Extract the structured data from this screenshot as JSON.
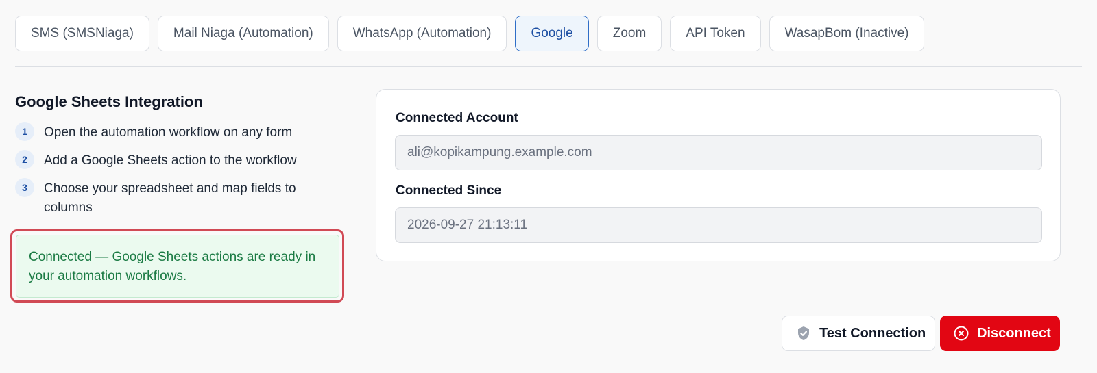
{
  "tabs": [
    {
      "label": "SMS (SMSNiaga)"
    },
    {
      "label": "Mail Niaga (Automation)"
    },
    {
      "label": "WhatsApp (Automation)"
    },
    {
      "label": "Google",
      "active": true
    },
    {
      "label": "Zoom"
    },
    {
      "label": "API Token"
    },
    {
      "label": "WasapBom (Inactive)"
    }
  ],
  "integration": {
    "title": "Google Sheets Integration",
    "steps": [
      {
        "number": "1",
        "text": "Open the automation workflow on any form"
      },
      {
        "number": "2",
        "text": "Add a Google Sheets action to the workflow"
      },
      {
        "number": "3",
        "text": "Choose your spreadsheet and map fields to columns"
      }
    ],
    "status_message": "Connected — Google Sheets actions are ready in your automation workflows."
  },
  "account": {
    "account_label": "Connected Account",
    "account_value": "ali@kopikampung.example.com",
    "since_label": "Connected Since",
    "since_value": "2026-09-27 21:13:11"
  },
  "actions": {
    "test_label": "Test Connection",
    "test_icon": "shield-check-icon",
    "disconnect_label": "Disconnect",
    "disconnect_icon": "circle-x-icon"
  },
  "colors": {
    "active_tab": "#1d4fa3",
    "success_text": "#1a7a43",
    "success_bg": "#ebfaef",
    "highlight_outline": "#d14a55",
    "danger": "#e20613"
  }
}
